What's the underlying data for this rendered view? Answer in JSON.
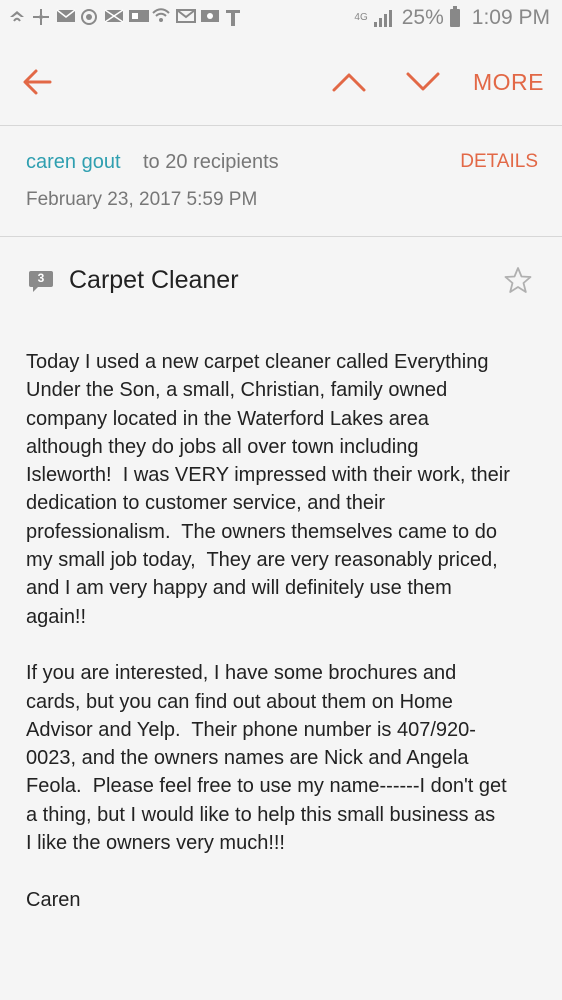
{
  "statusbar": {
    "icons": [
      "wifi-calling-icon",
      "yelp-icon",
      "mail-icon",
      "sync-icon",
      "email-icon",
      "gallery-icon",
      "wifi-icon",
      "gmail-icon",
      "photo-icon",
      "t-mobile-icon"
    ],
    "battery": "25%",
    "time": "1:09 PM"
  },
  "toolbar": {
    "more_label": "MORE"
  },
  "header": {
    "sender": "caren gout",
    "recipients": "to 20 recipients",
    "details_label": "DETAILS",
    "date": "February 23, 2017  5:59 PM"
  },
  "message": {
    "thread_count": "3",
    "subject": "Carpet Cleaner",
    "paragraphs": [
      [
        "Today I used a new carpet cleaner called Everything",
        "Under the Son, a small, Christian, family owned",
        "company located in the Waterford Lakes area",
        "although they do jobs all over town including",
        "Isleworth!  I was VERY impressed with their work, their",
        "dedication to customer service, and their",
        "professionalism.  The owners themselves came to do",
        "my small job today,  They are very reasonably priced,",
        "and I am very happy and will definitely use them",
        "again!!"
      ],
      [
        "If you are interested, I have some brochures and",
        "cards, but you can find out about them on Home",
        "Advisor and Yelp.  Their phone number is 407/920-",
        "0023, and the owners names are Nick and Angela",
        "Feola.  Please feel free to use my name------I don't get",
        "a thing, but I would like to help this small business as",
        "I like the owners very much!!!"
      ],
      [
        "Caren"
      ]
    ]
  },
  "colors": {
    "accent": "#e26846",
    "sender": "#2f9fb0",
    "muted": "#777777"
  }
}
